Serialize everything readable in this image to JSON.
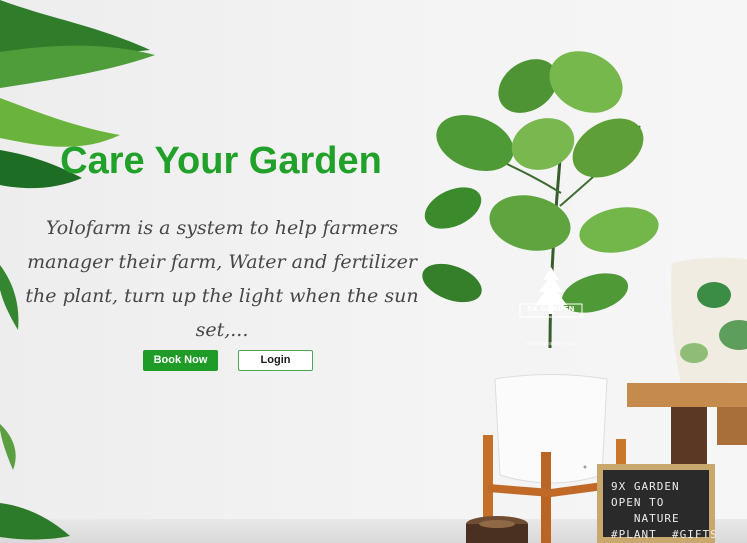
{
  "hero": {
    "title": "Care Your Garden",
    "description": "Yolofarm is a system to help farmers manager their farm, Water and fertilizer the plant, turn up the light when the sun set,...",
    "book_now_label": "Book Now",
    "login_label": "Login",
    "accent_color": "#21a12a"
  },
  "logo": {
    "name": "9X GARDEN",
    "website": "www.9xgarden.com"
  },
  "letter_board": {
    "text": "9X GARDEN\nOPEN TO\n   NATURE\n#PLANT  #GIFTS"
  }
}
